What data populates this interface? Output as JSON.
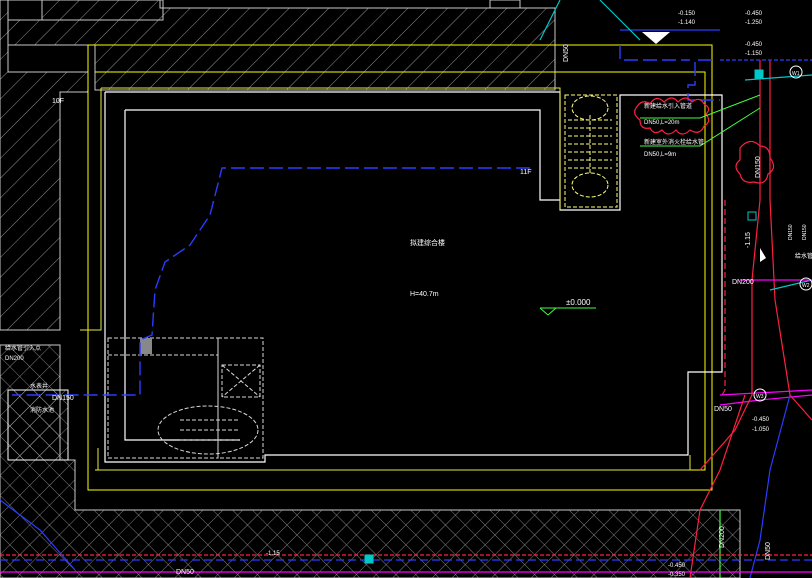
{
  "labels": {
    "floor_left": "10F",
    "floor_mid": "11F",
    "building_title": "拟建综合楼",
    "building_height": "H=40.7m",
    "elevation_zero": "±0.000",
    "dn50_top": "DN50",
    "dn50_left": "DN150",
    "dn200_right": "DN200",
    "dn50_right": "DN50",
    "dn50_bottom_right": "DN50",
    "dn200_bottom": "DN200",
    "dn50_bottom": "DN50",
    "dn150_vertical": "DN150",
    "dn50_far_right": "DN50",
    "elev_top_1": "-0.150",
    "elev_top_2": "-1.140",
    "elev_top_3": "-0.450",
    "elev_top_4": "-1.250",
    "elev_top_5": "-0.450",
    "elev_top_6": "-1.150",
    "elev_right_1": "-0.450",
    "elev_right_2": "-1.050",
    "elev_bottom_1": "-0.450",
    "elev_bottom_2": "-0.350",
    "elev_bottom_3": "-1.15",
    "elev_right_v": "-1.15",
    "note_1": "新建给水引入管道",
    "note_1_spec": "DN50,L=20m",
    "note_2": "新建室外消火栓给水管",
    "note_2_spec": "DN50,L=9m",
    "left_note_1": "给水管引入点",
    "left_note_2": "DN200",
    "left_note_3": "水表井",
    "left_note_4": "消防水池",
    "valve_1": "W1",
    "valve_2": "W2",
    "valve_3": "W3",
    "side_1": "DN150",
    "side_2": "DN150",
    "side_3": "给水管"
  },
  "colors": {
    "background": "#000000",
    "hatch": "#c8c8c8",
    "building": "#ffffff",
    "setback": "#ffff00",
    "water": "#2233ff",
    "stair": "#ffff80",
    "red": "#ff2040",
    "cyan": "#00c8c8",
    "green": "#40ff40",
    "magenta": "#ff00ff"
  }
}
